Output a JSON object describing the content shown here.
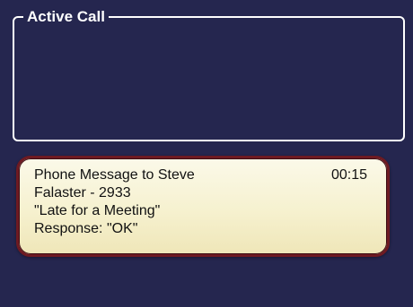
{
  "active_call": {
    "title": "Active Call"
  },
  "message": {
    "line1": "Phone Message to Steve",
    "line2": "Falaster - 2933",
    "line3": "\"Late for a Meeting\"",
    "line4": "Response: \"OK\"",
    "time": "00:15"
  },
  "colors": {
    "background": "#24254f",
    "card_fill": "#f6f1cf",
    "card_border": "#6e1a22",
    "group_border": "#ffffff"
  }
}
